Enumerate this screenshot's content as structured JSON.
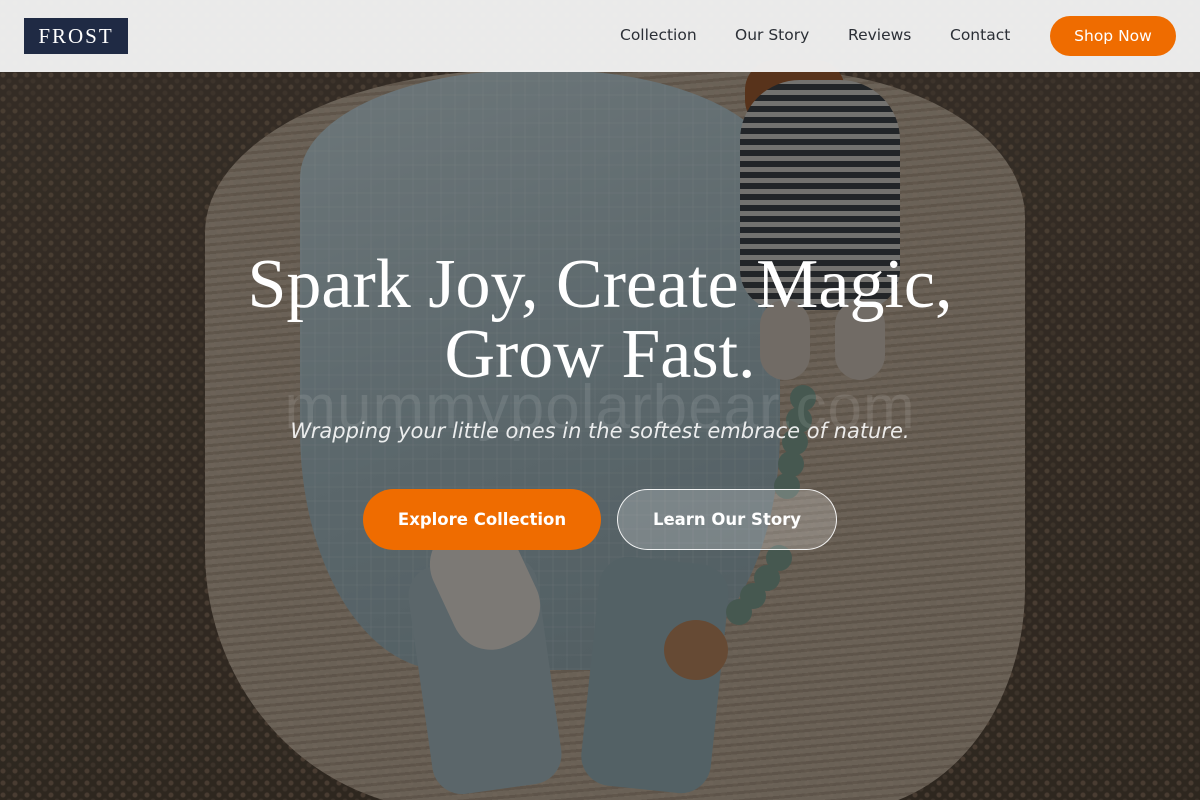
{
  "header": {
    "logo": "FROST",
    "nav": [
      "Collection",
      "Our Story",
      "Reviews",
      "Contact"
    ],
    "cta": "Shop Now"
  },
  "hero": {
    "title_line1": "Spark Joy, Create Magic,",
    "title_line2": "Grow Fast.",
    "subtitle": "Wrapping your little ones in the softest embrace of nature.",
    "primary_button": "Explore Collection",
    "secondary_button": "Learn Our Story",
    "watermark": "mummypolarbear.com"
  },
  "colors": {
    "accent": "#ef6c00",
    "logo_bg": "#1f2a44",
    "header_bg": "#f4f4f4"
  }
}
